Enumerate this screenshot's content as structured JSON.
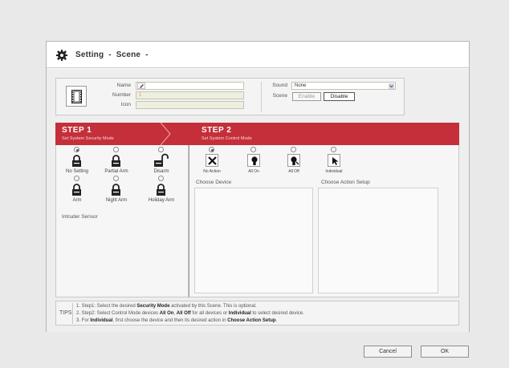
{
  "window": {
    "title": "Setting  -  Scene  -"
  },
  "scene_form": {
    "name_label": "Name",
    "name_value": "",
    "number_label": "Number",
    "number_value": "1",
    "icon_label": "Icon",
    "icon_value": "",
    "sound_label": "Sound",
    "sound_value": "None",
    "scene_label": "Scene",
    "enable_label": "Enable",
    "disable_label": "Disable"
  },
  "step1": {
    "heading": "STEP 1",
    "subheading": "Set System Security Mode",
    "modes": [
      {
        "label": "No Setting",
        "selected": true,
        "icon": "lock-icon"
      },
      {
        "label": "Partial Arm",
        "selected": false,
        "icon": "lock-icon"
      },
      {
        "label": "Disarm",
        "selected": false,
        "icon": "unlock-icon"
      },
      {
        "label": "Arm",
        "selected": false,
        "icon": "lock-icon"
      },
      {
        "label": "Night Arm",
        "selected": false,
        "icon": "lock-icon"
      },
      {
        "label": "Holiday Arm",
        "selected": false,
        "icon": "lock-icon"
      }
    ],
    "sensor_label": "Intruder Sensor"
  },
  "step2": {
    "heading": "STEP 2",
    "subheading": "Set System Control Mode",
    "controls": [
      {
        "label": "No Action",
        "selected": true,
        "icon": "x-icon"
      },
      {
        "label": "All On",
        "selected": false,
        "icon": "bulb-on-icon"
      },
      {
        "label": "All Off",
        "selected": false,
        "icon": "bulb-off-icon"
      },
      {
        "label": "Individual",
        "selected": false,
        "icon": "cursor-icon"
      }
    ],
    "choose_device_label": "Choose Device",
    "choose_action_label": "Choose Action Setup"
  },
  "tips": {
    "label": "TIPS",
    "line1_a": "1. Step1: Select the desired ",
    "line1_b": "Security Mode",
    "line1_c": " activated by this Scene. This is optional.",
    "line2_a": "2. Step2: Select Control Mode devices ",
    "line2_b": "All On",
    "line2_c": ", ",
    "line2_d": "All Off",
    "line2_e": " for all devices or ",
    "line2_f": "Individual",
    "line2_g": " to select desired device.",
    "line3_a": "3. For ",
    "line3_b": "Individual",
    "line3_c": ", first choose the device and then its desired action in ",
    "line3_d": "Choose Action Setup",
    "line3_e": "."
  },
  "footer": {
    "cancel_label": "Cancel",
    "ok_label": "OK"
  },
  "colors": {
    "step_bar": "#c42f3a",
    "field_bg": "#efefdf"
  }
}
